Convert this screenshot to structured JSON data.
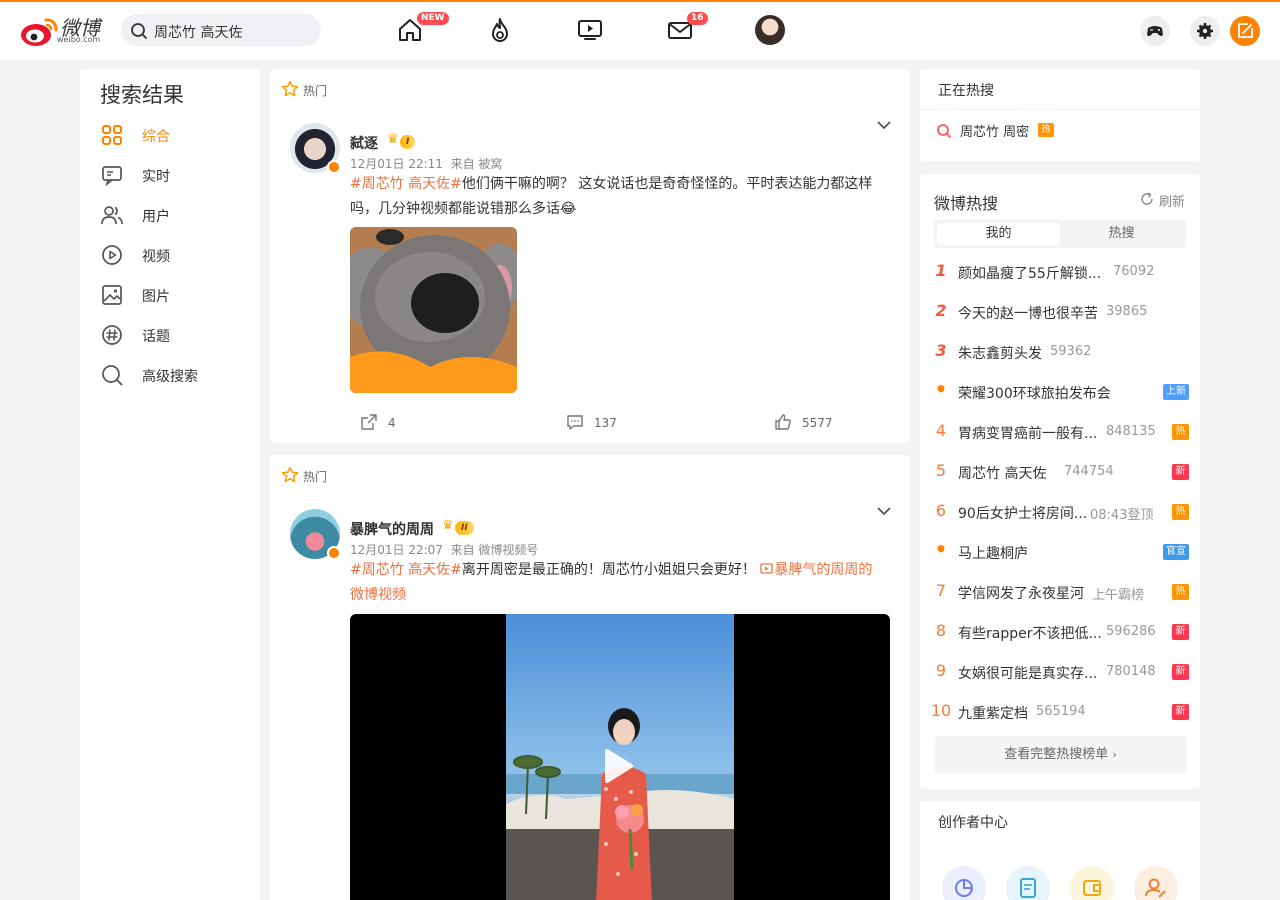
{
  "header": {
    "logo_text": "微博",
    "logo_sub": "weibo.com",
    "search": {
      "value": "周芯竹 高天佐"
    },
    "badges": {
      "home": "NEW",
      "messages": "16"
    }
  },
  "left_panel": {
    "title": "搜索结果",
    "items": [
      {
        "label": "综合",
        "icon": "grid-icon",
        "active": true
      },
      {
        "label": "实时",
        "icon": "realtime-icon"
      },
      {
        "label": "用户",
        "icon": "users-icon"
      },
      {
        "label": "视频",
        "icon": "video-icon"
      },
      {
        "label": "图片",
        "icon": "image-icon"
      },
      {
        "label": "话题",
        "icon": "hashtag-icon"
      },
      {
        "label": "高级搜索",
        "icon": "search-icon"
      }
    ]
  },
  "posts": [
    {
      "tag": "热门",
      "user": "弑逐",
      "level": "I",
      "time": "12月01日 22:11",
      "source": "来自 被窝",
      "hashtag": "#周芯竹 高天佐#",
      "text": "他们俩干嘛的啊？ 这女说话也是奇奇怪怪的。平时表达能力都这样吗，几分钟视频都能说错那么多话",
      "emoji": "😂",
      "reposts": "4",
      "comments": "137",
      "likes": "5577"
    },
    {
      "tag": "热门",
      "user": "暴脾气的周周",
      "level": "II",
      "time": "12月01日 22:07",
      "source": "来自 微博视频号",
      "hashtag": "#周芯竹 高天佐#",
      "text": "离开周密是最正确的！周芯竹小姐姐只会更好！",
      "video_link": "暴脾气的周周的微博视频"
    }
  ],
  "trending_now": {
    "title": "正在热搜",
    "item": "周芯竹 周密",
    "item_tag": "热"
  },
  "hot_search": {
    "title": "微博热搜",
    "refresh": "刷新",
    "tabs": [
      "我的",
      "热搜"
    ],
    "items": [
      {
        "rank": "1",
        "title": "颜如晶瘦了55斤解锁...",
        "count": "76092",
        "tag": ""
      },
      {
        "rank": "2",
        "title": "今天的赵一博也很辛苦",
        "count": "39865",
        "tag": ""
      },
      {
        "rank": "3",
        "title": "朱志鑫剪头发",
        "count": "59362",
        "tag": ""
      },
      {
        "rank": "•",
        "title": "荣耀300环球旅拍发布会",
        "count": "",
        "tag": "上新"
      },
      {
        "rank": "4",
        "title": "胃病变胃癌前一般有...",
        "count": "848135",
        "tag": "热"
      },
      {
        "rank": "5",
        "title": "周芯竹 高天佐",
        "count": "744754",
        "tag": "新"
      },
      {
        "rank": "6",
        "title": "90后女护士将房间...",
        "count": "08:43登顶",
        "tag": "热"
      },
      {
        "rank": "•",
        "title": "马上趣桐庐",
        "count": "",
        "tag": "官宣"
      },
      {
        "rank": "7",
        "title": "学信网发了永夜星河",
        "count": "上午霸榜",
        "tag": "热"
      },
      {
        "rank": "8",
        "title": "有些rapper不该把低...",
        "count": "596286",
        "tag": "新"
      },
      {
        "rank": "9",
        "title": "女娲很可能是真实存...",
        "count": "780148",
        "tag": "新"
      },
      {
        "rank": "10",
        "title": "九重紫定档",
        "count": "565194",
        "tag": "新"
      }
    ],
    "full_list": "查看完整热搜榜单"
  },
  "creator_center": {
    "title": "创作者中心"
  },
  "colors": {
    "accent": "#ff8200",
    "hot": "#ff9406",
    "new": "#ff3852",
    "up": "#4d9eff",
    "gov": "#3d9be9"
  }
}
